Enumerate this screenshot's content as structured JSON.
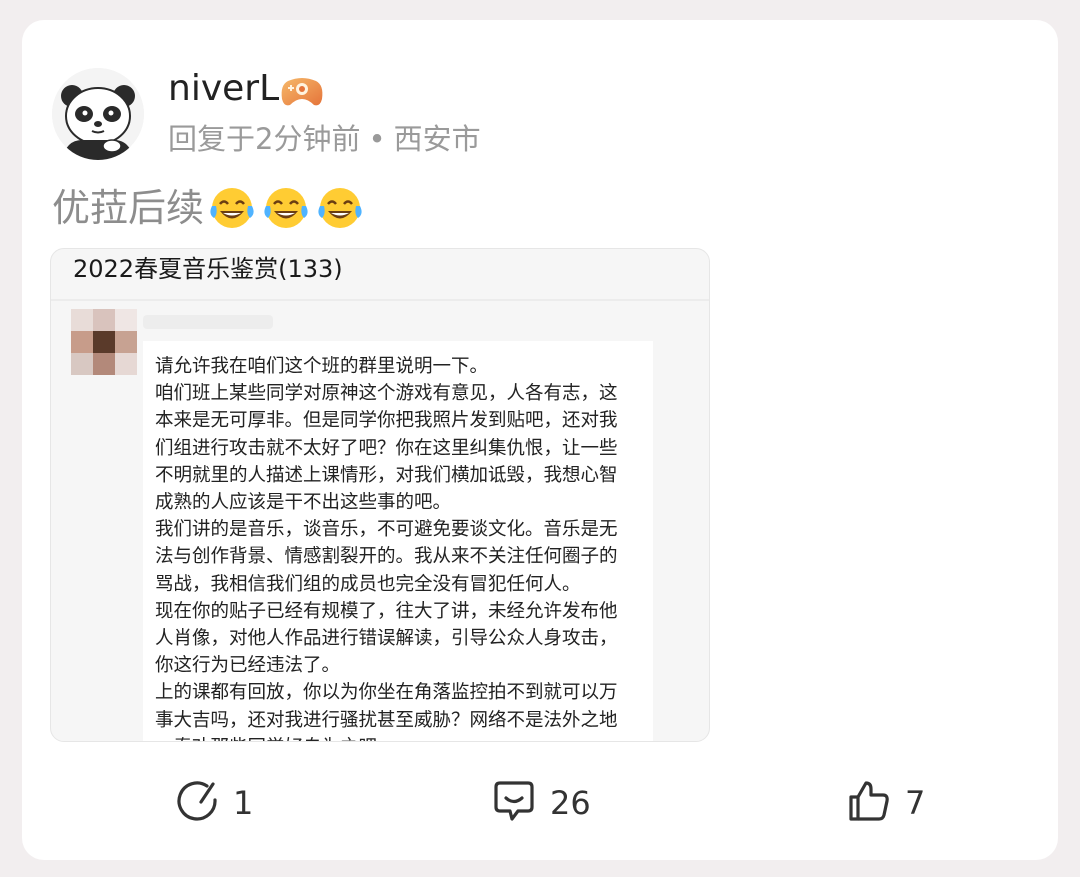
{
  "post": {
    "username": "niverL",
    "reply_time": "回复于2分钟前",
    "location": "西安市",
    "text": "优菈后续",
    "emoji_count": 3
  },
  "attached_image": {
    "group_title": "2022春夏音乐鉴赏(133)",
    "message_lines": [
      "请允许我在咱们这个班的群里说明一下。",
      "咱们班上某些同学对原神这个游戏有意见，人各有志，这",
      "本来是无可厚非。但是同学你把我照片发到贴吧，还对我",
      "们组进行攻击就不太好了吧？你在这里纠集仇恨，让一些",
      "不明就里的人描述上课情形，对我们横加诋毁，我想心智",
      "成熟的人应该是干不出这些事的吧。",
      "我们讲的是音乐，谈音乐，不可避免要谈文化。音乐是无",
      "法与创作背景、情感割裂开的。我从来不关注任何圈子的",
      "骂战，我相信我们组的成员也完全没有冒犯任何人。",
      "现在你的贴子已经有规模了，往大了讲，未经允许发布他",
      "人肖像，对他人作品进行错误解读，引导公众人身攻击，",
      "你这行为已经违法了。",
      "上的课都有回放，你以为你坐在角落监控拍不到就可以万",
      "事大吉吗，还对我进行骚扰甚至威胁？网络不是法外之地",
      "，奉劝那些同学好自为之吧"
    ]
  },
  "actions": {
    "share": {
      "icon": "share-icon",
      "count": "1"
    },
    "comment": {
      "icon": "comment-icon",
      "count": "26"
    },
    "like": {
      "icon": "thumbs-up-icon",
      "count": "7"
    }
  },
  "colors": {
    "background": "#f2eeef",
    "card": "#ffffff",
    "username": "#222222",
    "meta": "#9a9a9a",
    "post_text": "#8d8d8d"
  }
}
